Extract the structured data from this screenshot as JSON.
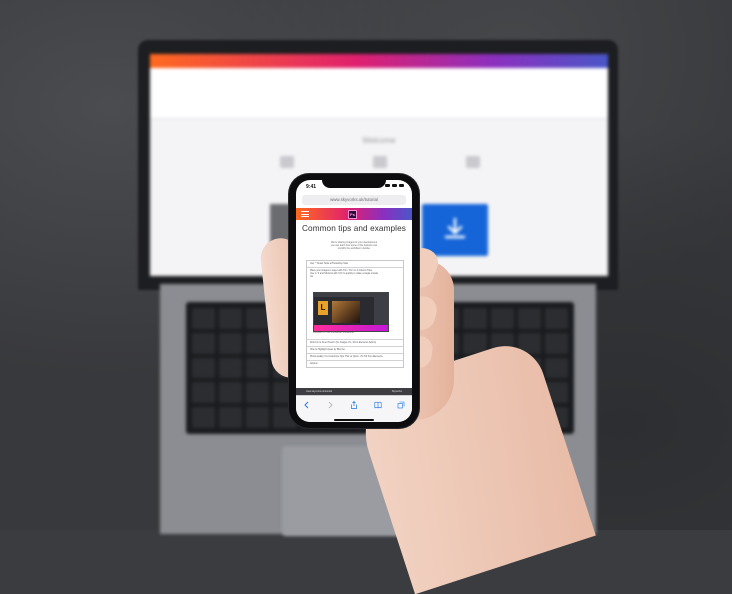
{
  "scene": {
    "description_colors": {
      "accent_gradient": [
        "#ff6a1f",
        "#e0206e",
        "#8c2fbf",
        "#4a56c8"
      ],
      "download_blue": "#1565d8"
    }
  },
  "laptop": {
    "welcome_text": "Welcome"
  },
  "phone": {
    "status_time": "9:41",
    "url": "www.skyvorks.uk/tutorial",
    "ps_logo": "Ps",
    "page_title": "Common tips and examples",
    "intro_lines": [
      "We're sharing images for your development",
      "you can learn how some of the features can",
      "simplify the workflow in Adobe"
    ],
    "tips": [
      "Use \"\" Smart Tools a Photoshop Task",
      "Fix all spot, stack and \"Blend\" an Image",
      "Dont Fix to Inner Pixel/s: (for Images, Ps, 3/4 in Elements Action)",
      "How to Highlight Areas by Blur the",
      "Photo-quality: Fix Customize Tips Thin vs Quick · Ps 3/4 from Elements",
      "Actions"
    ],
    "expanded_tip_lines": [
      "Place your images in Layer with 'Fix' / 'Fix' on 4 Column Tiles,",
      "Use 1 / 3 and Shortcut with 'Ctrl' to quickly to make a single mosaic",
      "Go"
    ],
    "expanded_tip_image_letter": "L",
    "expanded_tip_caption": "Fix Action Ps Tool in Elements and Actions",
    "bottom_strip_left": "www.skyvorks.uk/tutorial",
    "bottom_strip_right": "Skyworks"
  }
}
